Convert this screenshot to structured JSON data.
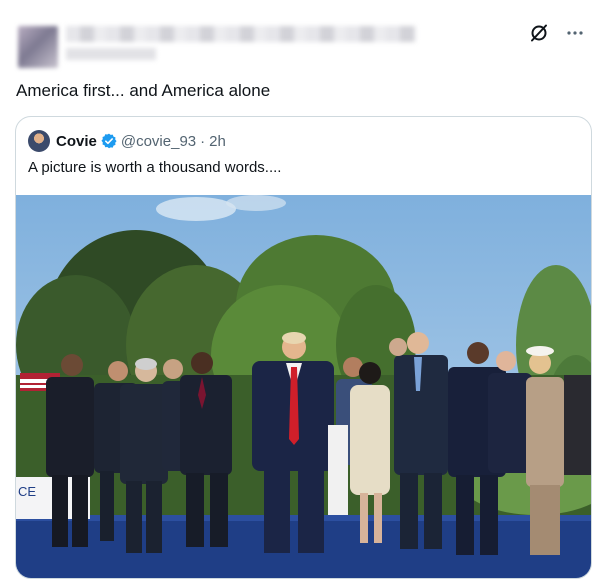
{
  "post": {
    "text": "America first... and America alone",
    "icons": [
      "grok-icon",
      "more-icon"
    ],
    "more_label": "···"
  },
  "quote": {
    "name": "Covie",
    "handle": "@covie_93",
    "separator": "·",
    "time": "2h",
    "text": "A picture is worth a thousand words....",
    "verified_color": "#1d9bf0",
    "sign_text": "CE"
  },
  "colors": {
    "text": "#0f1419",
    "secondary": "#536471",
    "border": "#cfd9de",
    "sky": "#9ec3e4",
    "stage": "#1f3e86"
  }
}
